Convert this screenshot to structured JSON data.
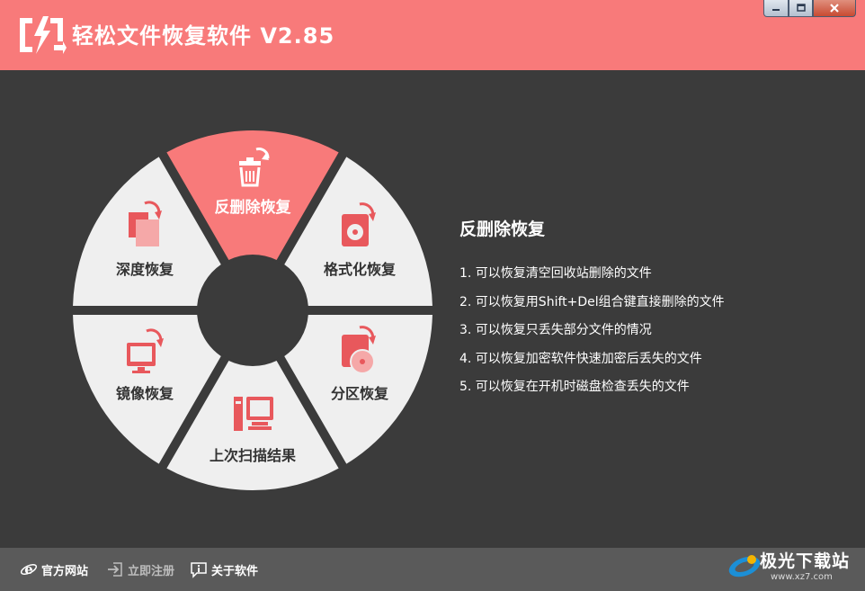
{
  "app": {
    "title": "轻松文件恢复软件 V2.85"
  },
  "wheel": {
    "segments": [
      {
        "key": "undelete",
        "label": "反删除恢复",
        "icon": "trash-restore-icon",
        "active": true
      },
      {
        "key": "format",
        "label": "格式化恢复",
        "icon": "disk-format-icon",
        "active": false
      },
      {
        "key": "partition",
        "label": "分区恢复",
        "icon": "partition-disc-icon",
        "active": false
      },
      {
        "key": "last-scan",
        "label": "上次扫描结果",
        "icon": "pc-scan-icon",
        "active": false
      },
      {
        "key": "mirror",
        "label": "镜像恢复",
        "icon": "monitor-image-icon",
        "active": false
      },
      {
        "key": "deep",
        "label": "深度恢复",
        "icon": "documents-deep-icon",
        "active": false
      }
    ]
  },
  "description": {
    "title": "反删除恢复",
    "items": [
      "1. 可以恢复清空回收站删除的文件",
      "2. 可以恢复用Shift+Del组合键直接删除的文件",
      "3. 可以恢复只丢失部分文件的情况",
      "4. 可以恢复加密软件快速加密后丢失的文件",
      "5. 可以恢复在开机时磁盘检查丢失的文件"
    ]
  },
  "footer": {
    "website": "官方网站",
    "register": "立即注册",
    "about": "关于软件"
  },
  "watermark": {
    "text": "极光下载站",
    "sub": "www.xz7.com"
  },
  "colors": {
    "accent": "#f87a7a",
    "icon": "#e8585c",
    "segment": "#efefef",
    "background": "#3b3b3b"
  }
}
